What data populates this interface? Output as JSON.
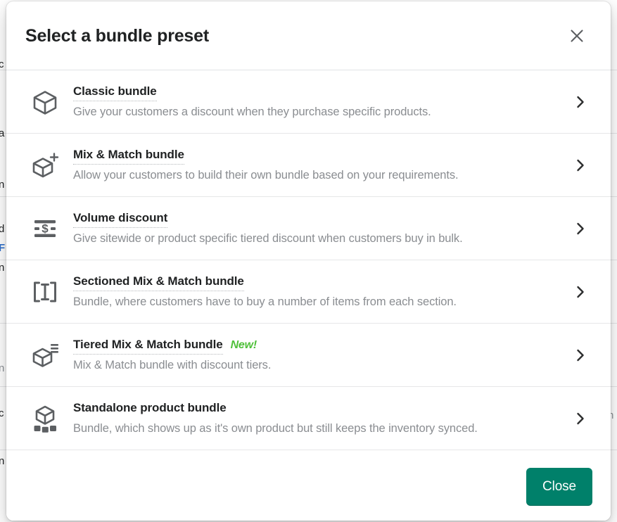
{
  "modal": {
    "title": "Select a bundle preset",
    "close_icon": "close-icon",
    "presets": [
      {
        "icon": "box-icon",
        "title": "Classic bundle",
        "description": "Give your customers a discount when they purchase specific products.",
        "badge": "",
        "chevron": "chevron-right-icon"
      },
      {
        "icon": "box-plus-icon",
        "title": "Mix & Match bundle",
        "description": "Allow your customers to build their own bundle based on your requirements.",
        "badge": "",
        "chevron": "chevron-right-icon"
      },
      {
        "icon": "dollar-tiers-icon",
        "title": "Volume discount",
        "description": "Give sitewide or product specific tiered discount when customers buy in bulk.",
        "badge": "",
        "chevron": "chevron-right-icon"
      },
      {
        "icon": "brackets-column-icon",
        "title": "Sectioned Mix & Match bundle",
        "description": "Bundle, where customers have to buy a number of items from each section.",
        "badge": "",
        "chevron": "chevron-right-icon"
      },
      {
        "icon": "box-tiers-icon",
        "title": "Tiered Mix & Match bundle",
        "description": "Mix & Match bundle with discount tiers.",
        "badge": "New!",
        "chevron": "chevron-right-icon"
      },
      {
        "icon": "box-components-icon",
        "title": "Standalone product bundle",
        "description": "Bundle, which shows up as it's own product but still keeps the inventory synced.",
        "badge": "",
        "chevron": "chevron-right-icon"
      }
    ],
    "footer": {
      "close_label": "Close"
    }
  },
  "colors": {
    "primary_button": "#00806a",
    "badge_new": "#4fc03a",
    "title_text": "#202223",
    "description_text": "#8a8d91",
    "icon": "#5c5f62",
    "divider": "#e6e7e8",
    "background_link": "#2c6ecb"
  },
  "background_page": {
    "left_fragments": [
      "c",
      "a",
      "n",
      "d",
      "F",
      "n",
      "n",
      "c",
      "n"
    ],
    "right_fragments": [
      "i",
      "n"
    ]
  }
}
